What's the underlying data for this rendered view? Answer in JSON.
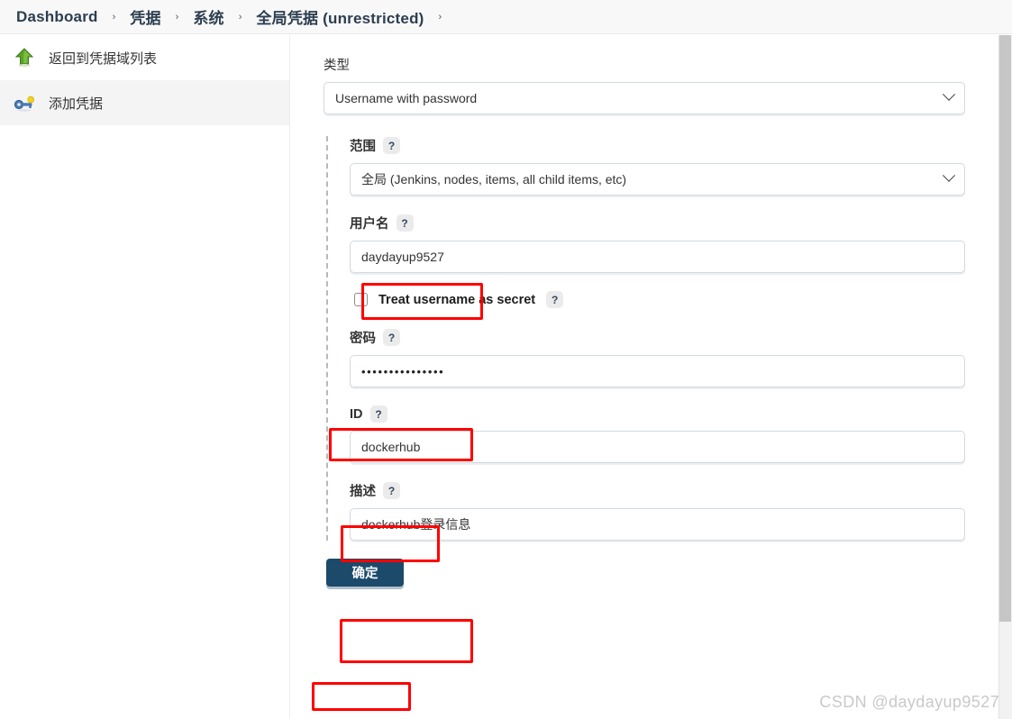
{
  "breadcrumb": {
    "separator": "›",
    "items": [
      {
        "label": "Dashboard"
      },
      {
        "label": "凭据"
      },
      {
        "label": "系统"
      },
      {
        "label": "全局凭据 (unrestricted)"
      }
    ]
  },
  "sidebar": {
    "items": [
      {
        "label": "返回到凭据域列表",
        "icon": "up-arrow-icon",
        "active": false
      },
      {
        "label": "添加凭据",
        "icon": "key-icon",
        "active": true
      }
    ]
  },
  "form": {
    "type": {
      "label": "类型",
      "value": "Username with password"
    },
    "scope": {
      "label": "范围",
      "help": "?",
      "value": "全局 (Jenkins, nodes, items, all child items, etc)"
    },
    "username": {
      "label": "用户名",
      "help": "?",
      "value": "daydayup9527"
    },
    "treat_secret": {
      "label": "Treat username as secret",
      "help": "?",
      "checked": false
    },
    "password": {
      "label": "密码",
      "help": "?",
      "value": "•••••••••••••••"
    },
    "id": {
      "label": "ID",
      "help": "?",
      "value": "dockerhub"
    },
    "description": {
      "label": "描述",
      "help": "?",
      "value": "dockerhub登录信息"
    },
    "submit": {
      "label": "确定"
    }
  },
  "watermark": {
    "text": "CSDN @daydayup9527"
  },
  "colors": {
    "annotation": "#ff0000",
    "submit_bg": "#1b4a6b",
    "breadcrumb_bg": "#f8f8f8",
    "sidebar_active_bg": "#f4f4f4"
  }
}
